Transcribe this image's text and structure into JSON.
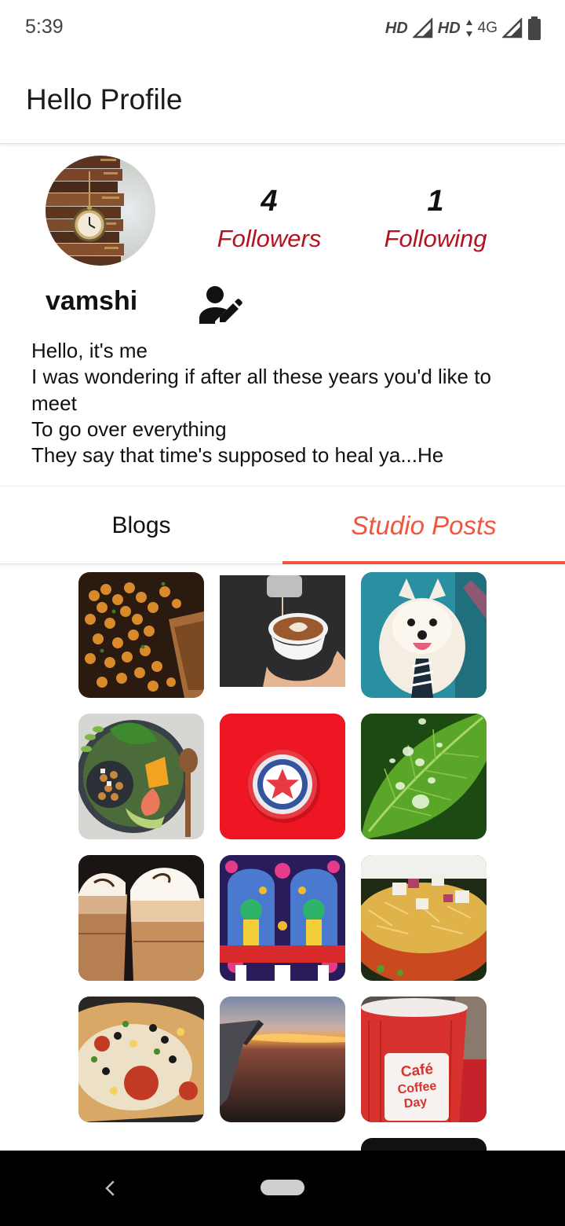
{
  "status_bar": {
    "time": "5:39",
    "hd1": "HD",
    "hd2": "HD",
    "network": "4G"
  },
  "app_bar": {
    "title": "Hello Profile"
  },
  "profile": {
    "username": "vamshi",
    "followers_count": "4",
    "followers_label": "Followers",
    "following_count": "1",
    "following_label": "Following",
    "bio": "Hello, it's me\nI was wondering if after all these years you'd like to meet\nTo go over everything\nThey say that time's supposed to heal ya...He"
  },
  "tabs": {
    "items": [
      {
        "label": "Blogs",
        "selected": false
      },
      {
        "label": "Studio Posts",
        "selected": true
      }
    ],
    "accent_color": "#f2553d"
  },
  "posts": [
    {
      "name": "chickpeas-dish"
    },
    {
      "name": "latte-art"
    },
    {
      "name": "pomeranian-dog"
    },
    {
      "name": "salad-bowl"
    },
    {
      "name": "shield-logo"
    },
    {
      "name": "water-drops-leaf"
    },
    {
      "name": "cold-coffee-glasses"
    },
    {
      "name": "temple-deities"
    },
    {
      "name": "sev-puri"
    },
    {
      "name": "pizza"
    },
    {
      "name": "sunset-plane-wing"
    },
    {
      "name": "cafe-coffee-day-cup"
    }
  ],
  "cafe_cup_text": [
    "Café",
    "Coffee",
    "Day"
  ],
  "colors": {
    "stat_label": "#b3121f",
    "tab_active": "#f2553d",
    "shield_bg": "#ee1622"
  }
}
